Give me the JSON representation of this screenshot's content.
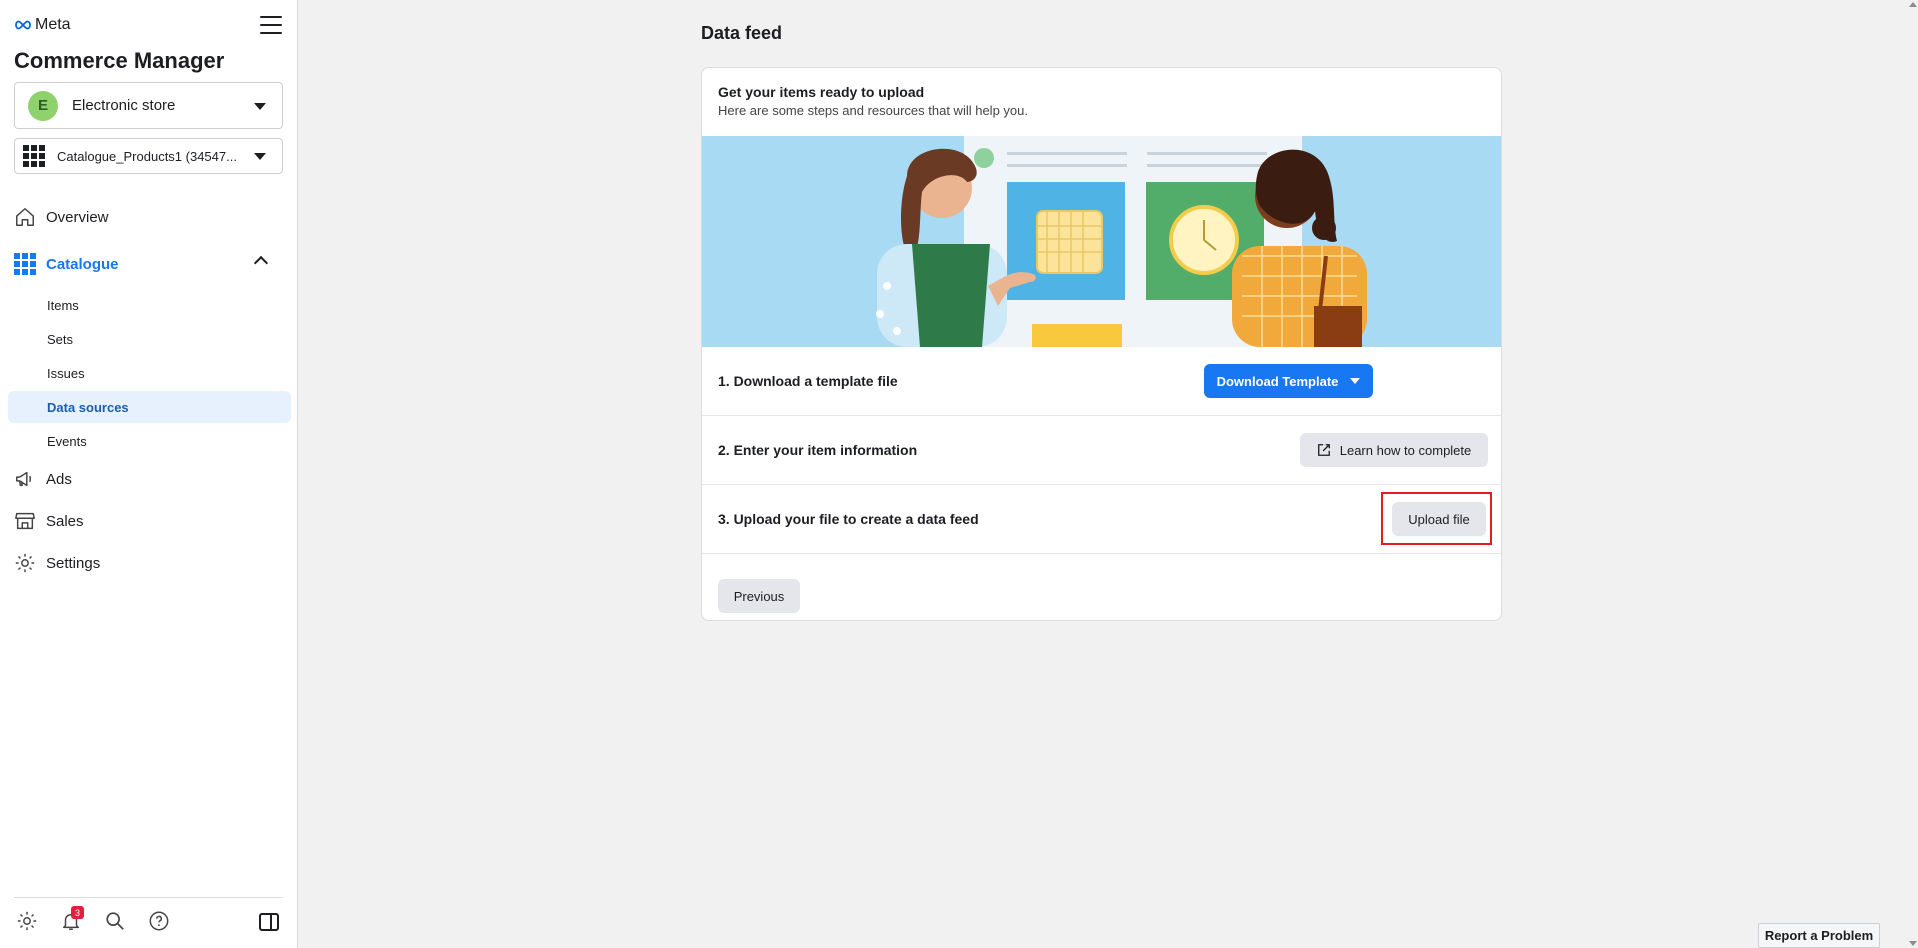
{
  "brand": {
    "logo_text": "Meta",
    "app_title": "Commerce Manager",
    "accent_color": "#1877f2"
  },
  "store_selector": {
    "avatar_letter": "E",
    "name": "Electronic store"
  },
  "catalogue_selector": {
    "name": "Catalogue_Products1 (34547..."
  },
  "nav": {
    "overview": "Overview",
    "catalogue": "Catalogue",
    "catalogue_items": [
      "Items",
      "Sets",
      "Issues",
      "Data sources",
      "Events"
    ],
    "selected_sub": "Data sources",
    "ads": "Ads",
    "sales": "Sales",
    "settings": "Settings"
  },
  "footer": {
    "notification_count": "3"
  },
  "main": {
    "page_title": "Data feed",
    "card_title": "Get your items ready to upload",
    "card_subtitle": "Here are some steps and resources that will help you.",
    "steps": [
      {
        "text": "1. Download a template file",
        "button": "Download Template"
      },
      {
        "text": "2. Enter your item information",
        "button": "Learn how to complete"
      },
      {
        "text": "3. Upload your file to create a data feed",
        "button": "Upload file"
      }
    ],
    "previous_button": "Previous"
  },
  "report_button": "Report a Problem"
}
